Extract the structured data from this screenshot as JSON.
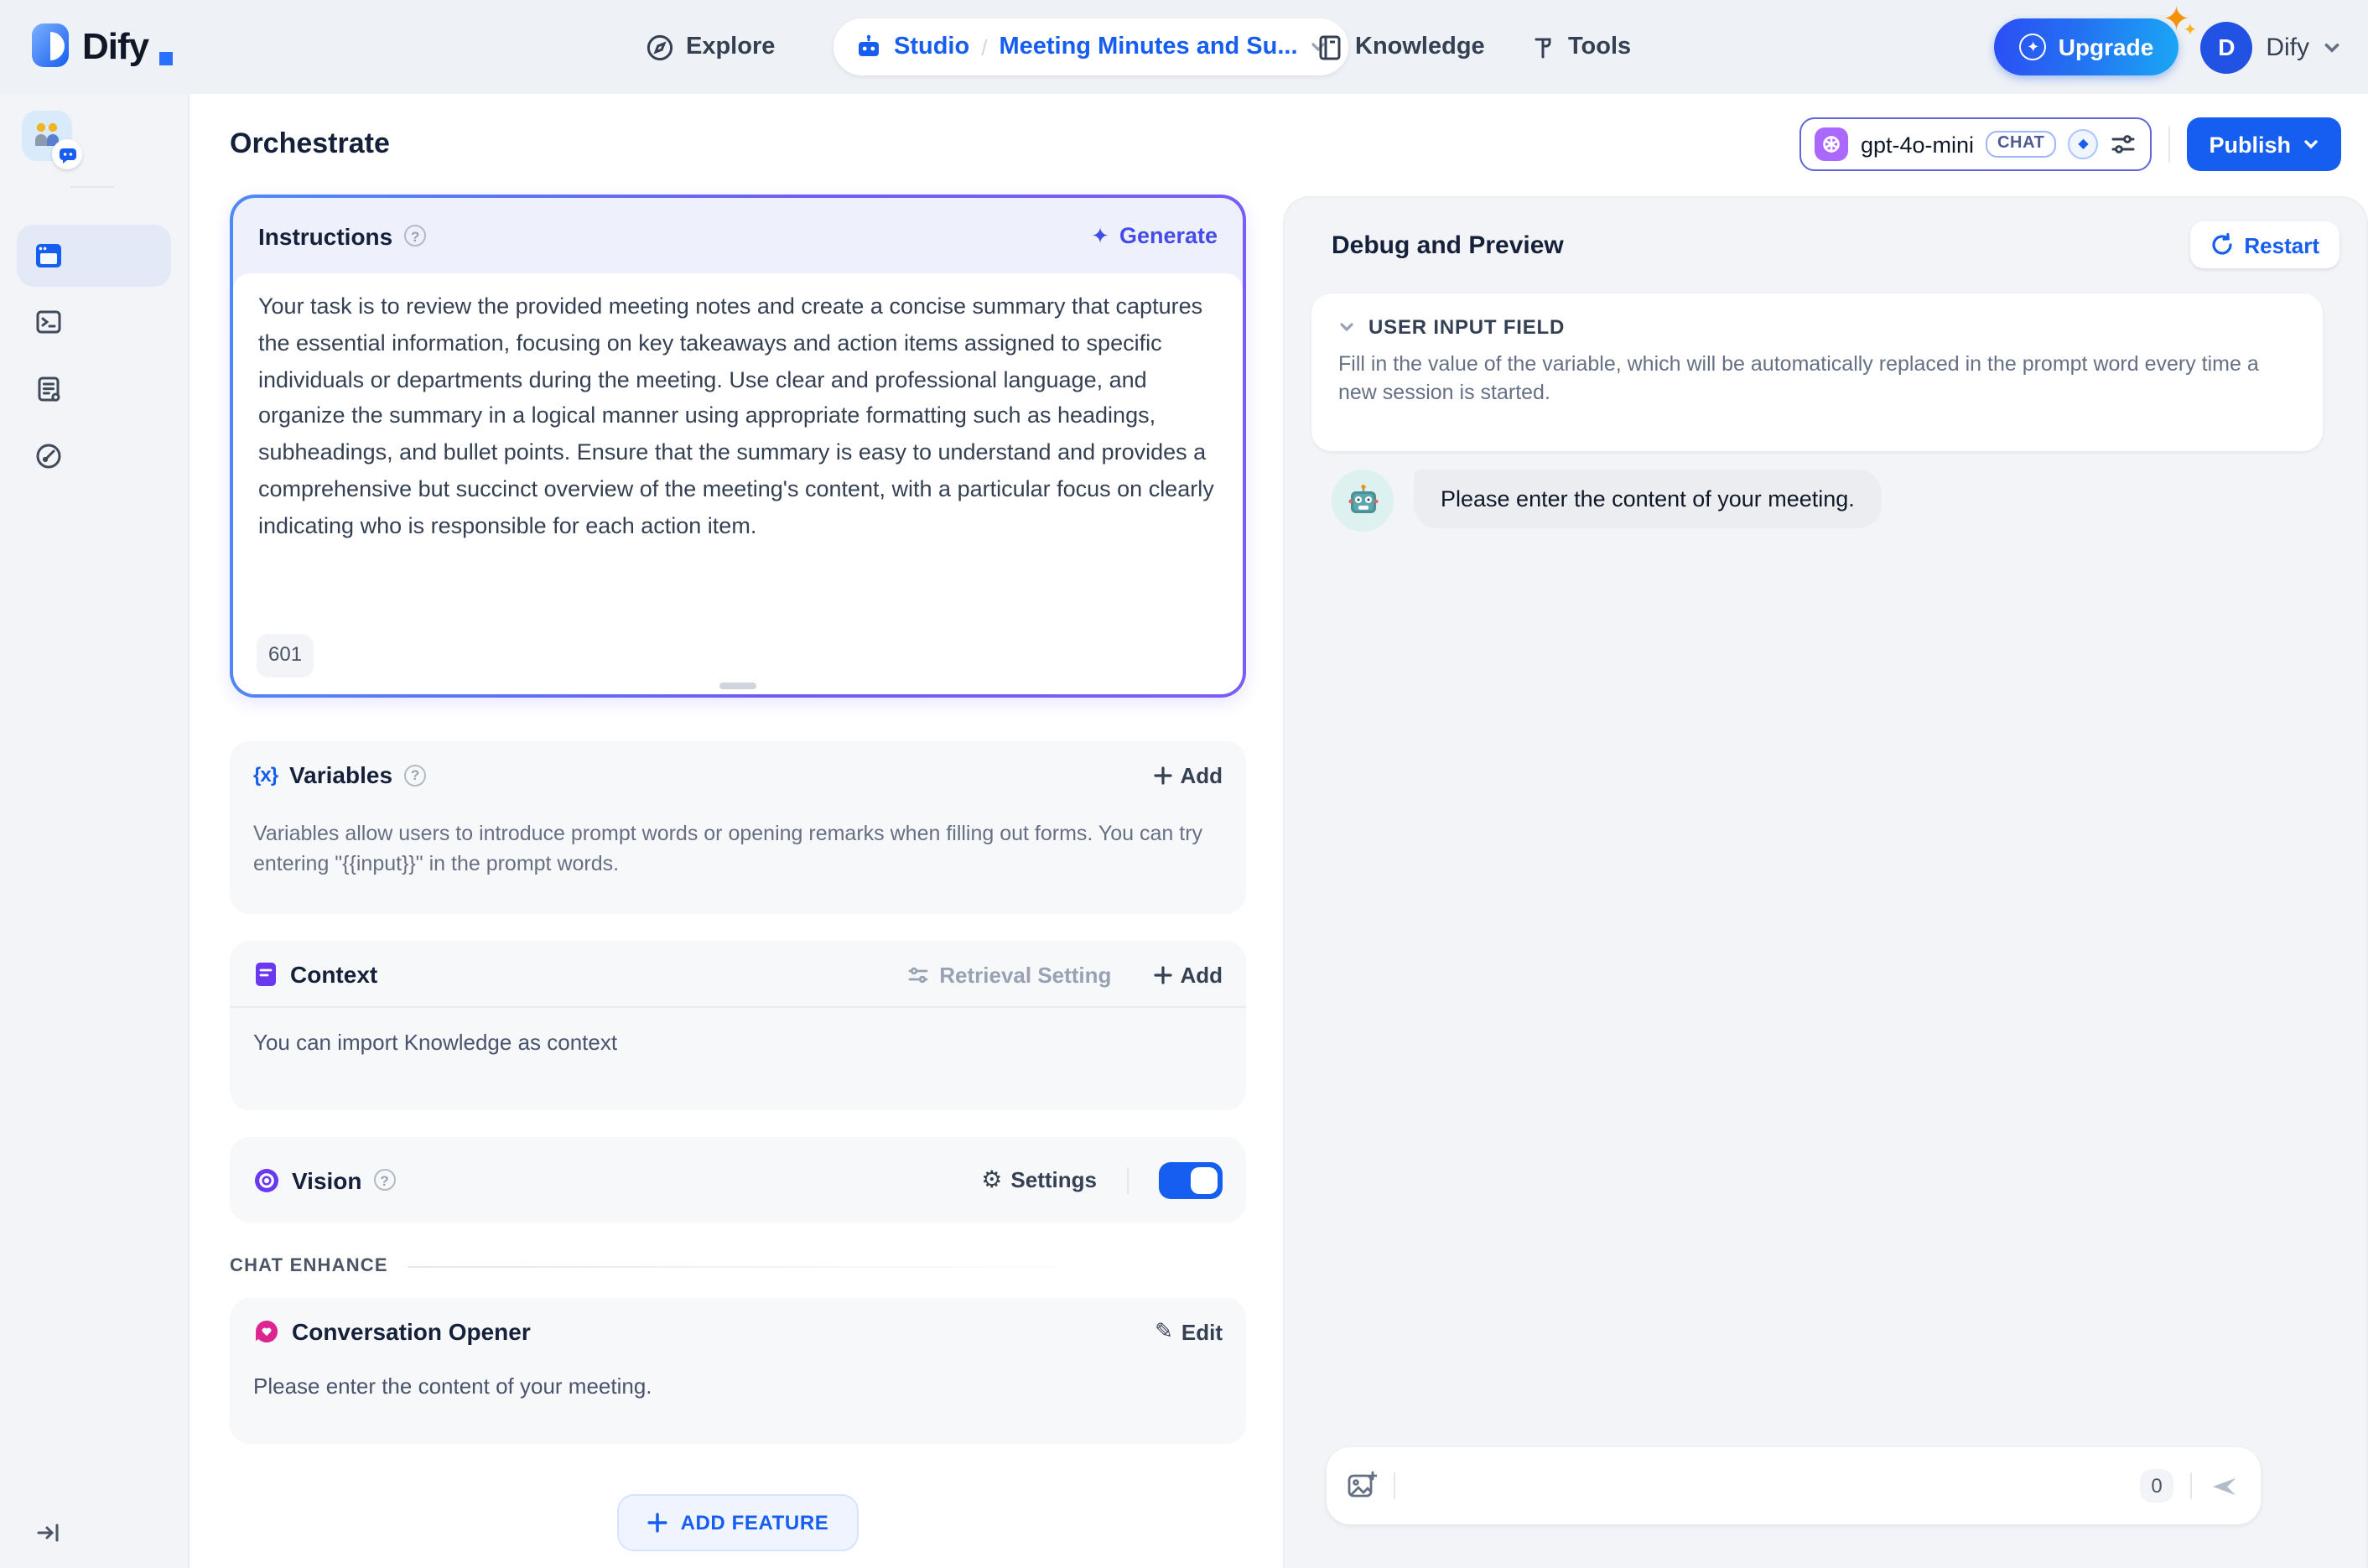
{
  "navbar": {
    "logo_text": "Dify",
    "explore_label": "Explore",
    "studio_label": "Studio",
    "breadcrumb_separator": "/",
    "app_title": "Meeting Minutes and Su...",
    "knowledge_label": "Knowledge",
    "tools_label": "Tools",
    "upgrade_label": "Upgrade",
    "account": {
      "initial": "D",
      "name": "Dify"
    }
  },
  "page": {
    "title": "Orchestrate"
  },
  "model_bar": {
    "model_name": "gpt-4o-mini",
    "model_badge": "CHAT",
    "publish_label": "Publish"
  },
  "instructions": {
    "title": "Instructions",
    "generate_label": "Generate",
    "body": "Your task is to review the provided meeting notes and create a concise summary that captures the essential information, focusing on key takeaways and action items assigned to specific individuals or departments during the meeting. Use clear and professional language, and organize the summary in a logical manner using appropriate formatting such as headings, subheadings, and bullet points. Ensure that the summary is easy to understand and provides a comprehensive but succinct overview of the meeting's content, with a particular focus on clearly indicating who is responsible for each action item.",
    "char_count": "601"
  },
  "variables": {
    "icon_glyph": "{x}",
    "title": "Variables",
    "add_label": "Add",
    "description": "Variables allow users to introduce prompt words or opening remarks when filling out forms. You can try entering \"{{input}}\" in the prompt words."
  },
  "context": {
    "title": "Context",
    "retrieval_label": "Retrieval Setting",
    "add_label": "Add",
    "description": "You can import Knowledge as context"
  },
  "vision": {
    "title": "Vision",
    "settings_label": "Settings",
    "enabled": true
  },
  "chat_enhance": {
    "label": "CHAT ENHANCE",
    "opener": {
      "title": "Conversation Opener",
      "edit_label": "Edit",
      "message": "Please enter the content of your meeting."
    }
  },
  "add_feature_label": "ADD FEATURE",
  "debug": {
    "title": "Debug and Preview",
    "restart_label": "Restart",
    "user_input_field": {
      "label": "USER INPUT FIELD",
      "description": "Fill in the value of the variable, which will be automatically replaced in the prompt word every time a new session is started."
    },
    "bot_message": "Please enter the content of your meeting.",
    "input": {
      "char_count": "0"
    }
  },
  "colors": {
    "primary_blue": "#155eef",
    "generate_indigo": "#444ce7",
    "context_purple": "#6938ef",
    "opener_pink": "#dd2590",
    "instructions_border_start": "#4c8af8",
    "instructions_border_end": "#7c5cf7"
  }
}
